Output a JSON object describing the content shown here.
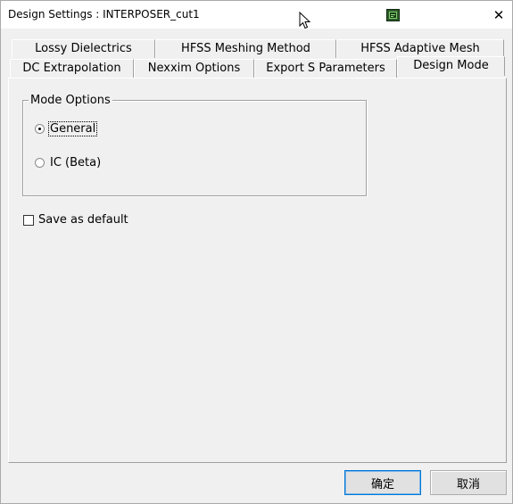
{
  "window": {
    "title": "Design Settings : INTERPOSER_cut1",
    "close_symbol": "✕"
  },
  "tabs_row_back": [
    {
      "label": "Lossy Dielectrics"
    },
    {
      "label": "HFSS Meshing Method"
    },
    {
      "label": "HFSS Adaptive Mesh"
    }
  ],
  "tabs_row_front": [
    {
      "label": "DC Extrapolation"
    },
    {
      "label": "Nexxim Options"
    },
    {
      "label": "Export S Parameters"
    },
    {
      "label": "Design Mode"
    }
  ],
  "active_tab": "Design Mode",
  "mode_options": {
    "title": "Mode Options",
    "options": [
      {
        "label": "General",
        "selected": true
      },
      {
        "label": "IC (Beta)",
        "selected": false
      }
    ]
  },
  "save_default": {
    "label": "Save as default",
    "checked": false
  },
  "buttons": {
    "ok": "确定",
    "cancel": "取消"
  }
}
